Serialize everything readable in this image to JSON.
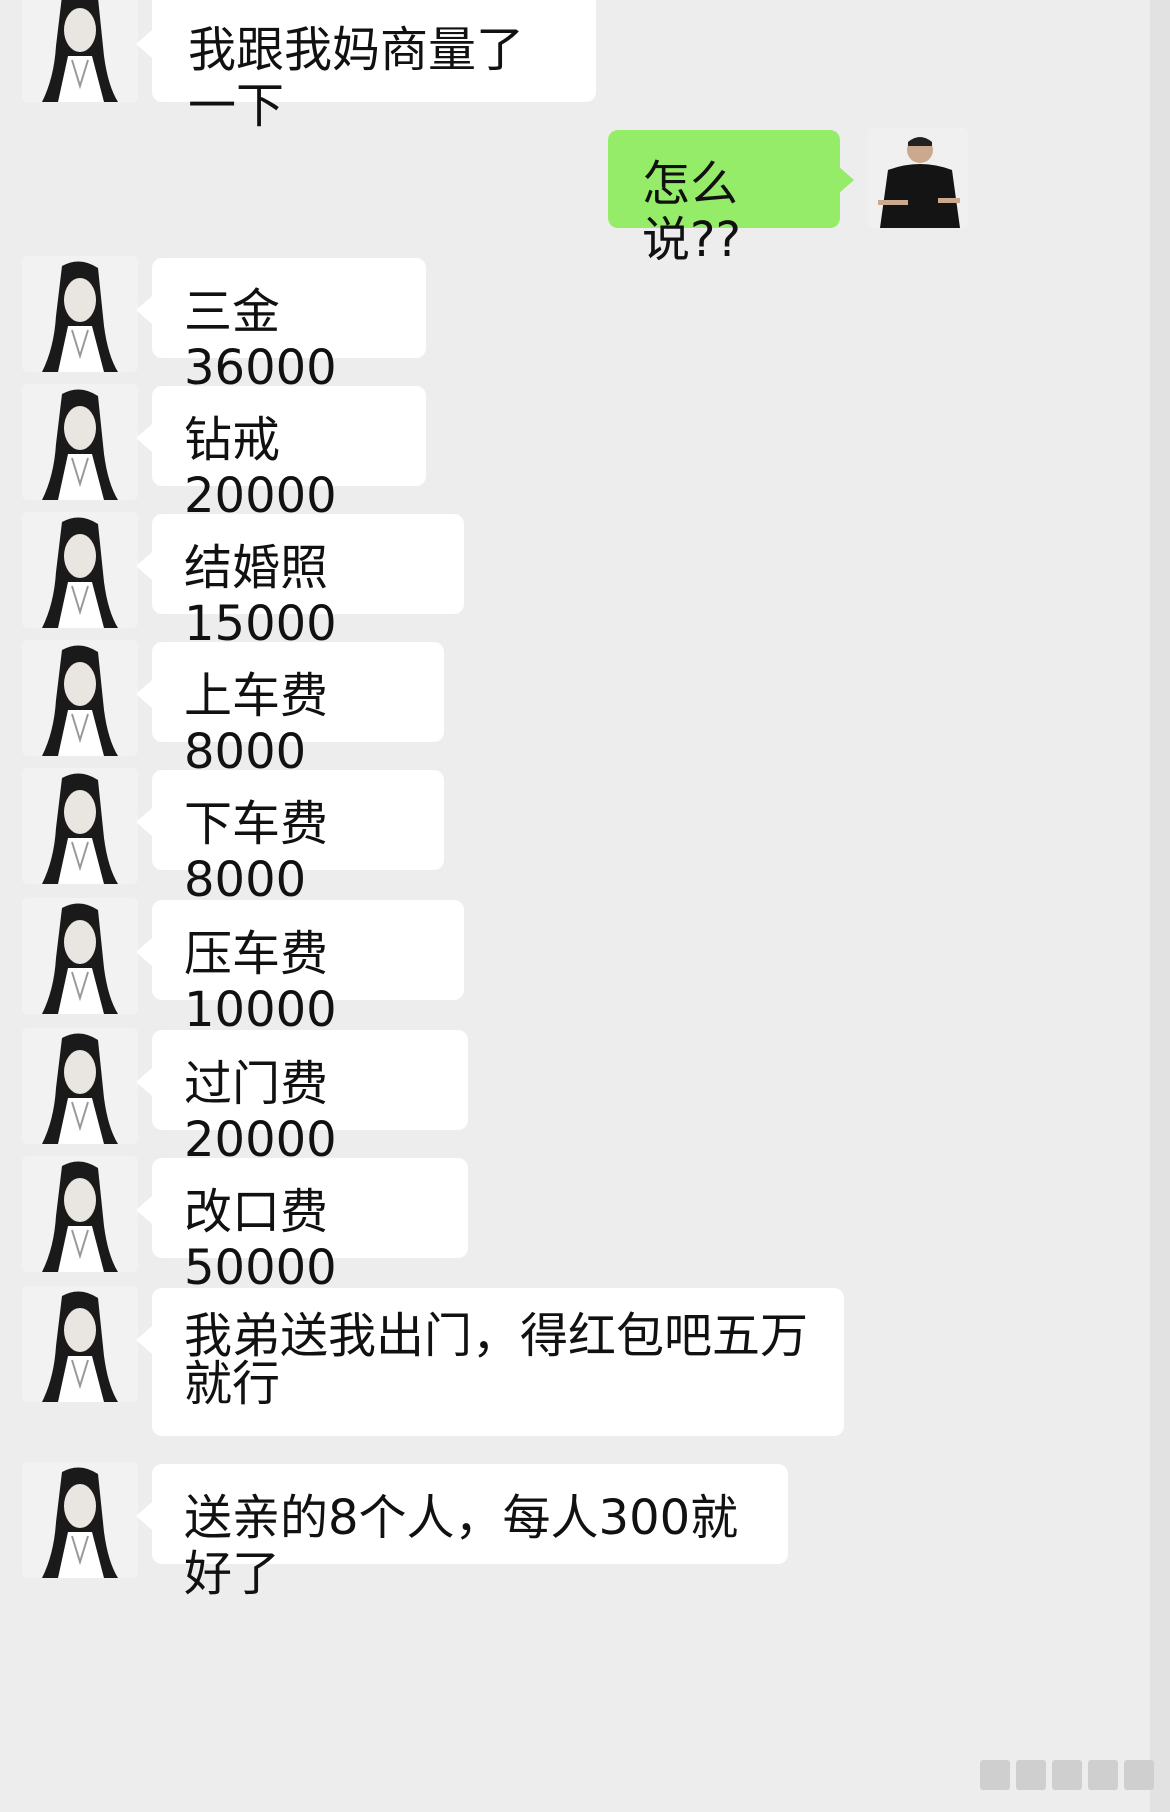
{
  "colors": {
    "background": "#ededed",
    "incoming_bubble": "#ffffff",
    "outgoing_bubble": "#95ec69"
  },
  "messages": [
    {
      "sender": "her",
      "text": "我跟我妈商量了一下"
    },
    {
      "sender": "me",
      "text": "怎么说??"
    },
    {
      "sender": "her",
      "text": "三金36000"
    },
    {
      "sender": "her",
      "text": "钻戒20000"
    },
    {
      "sender": "her",
      "text": "结婚照15000"
    },
    {
      "sender": "her",
      "text": "上车费8000"
    },
    {
      "sender": "her",
      "text": "下车费8000"
    },
    {
      "sender": "her",
      "text": "压车费10000"
    },
    {
      "sender": "her",
      "text": "过门费20000"
    },
    {
      "sender": "her",
      "text": "改口费50000"
    },
    {
      "sender": "her",
      "text": "我弟送我出门，得红包吧五万就行"
    },
    {
      "sender": "her",
      "text": "送亲的8个人，每人300就好了"
    }
  ],
  "icons": {
    "her_avatar": "woman-portrait-avatar",
    "my_avatar": "man-portrait-avatar"
  }
}
